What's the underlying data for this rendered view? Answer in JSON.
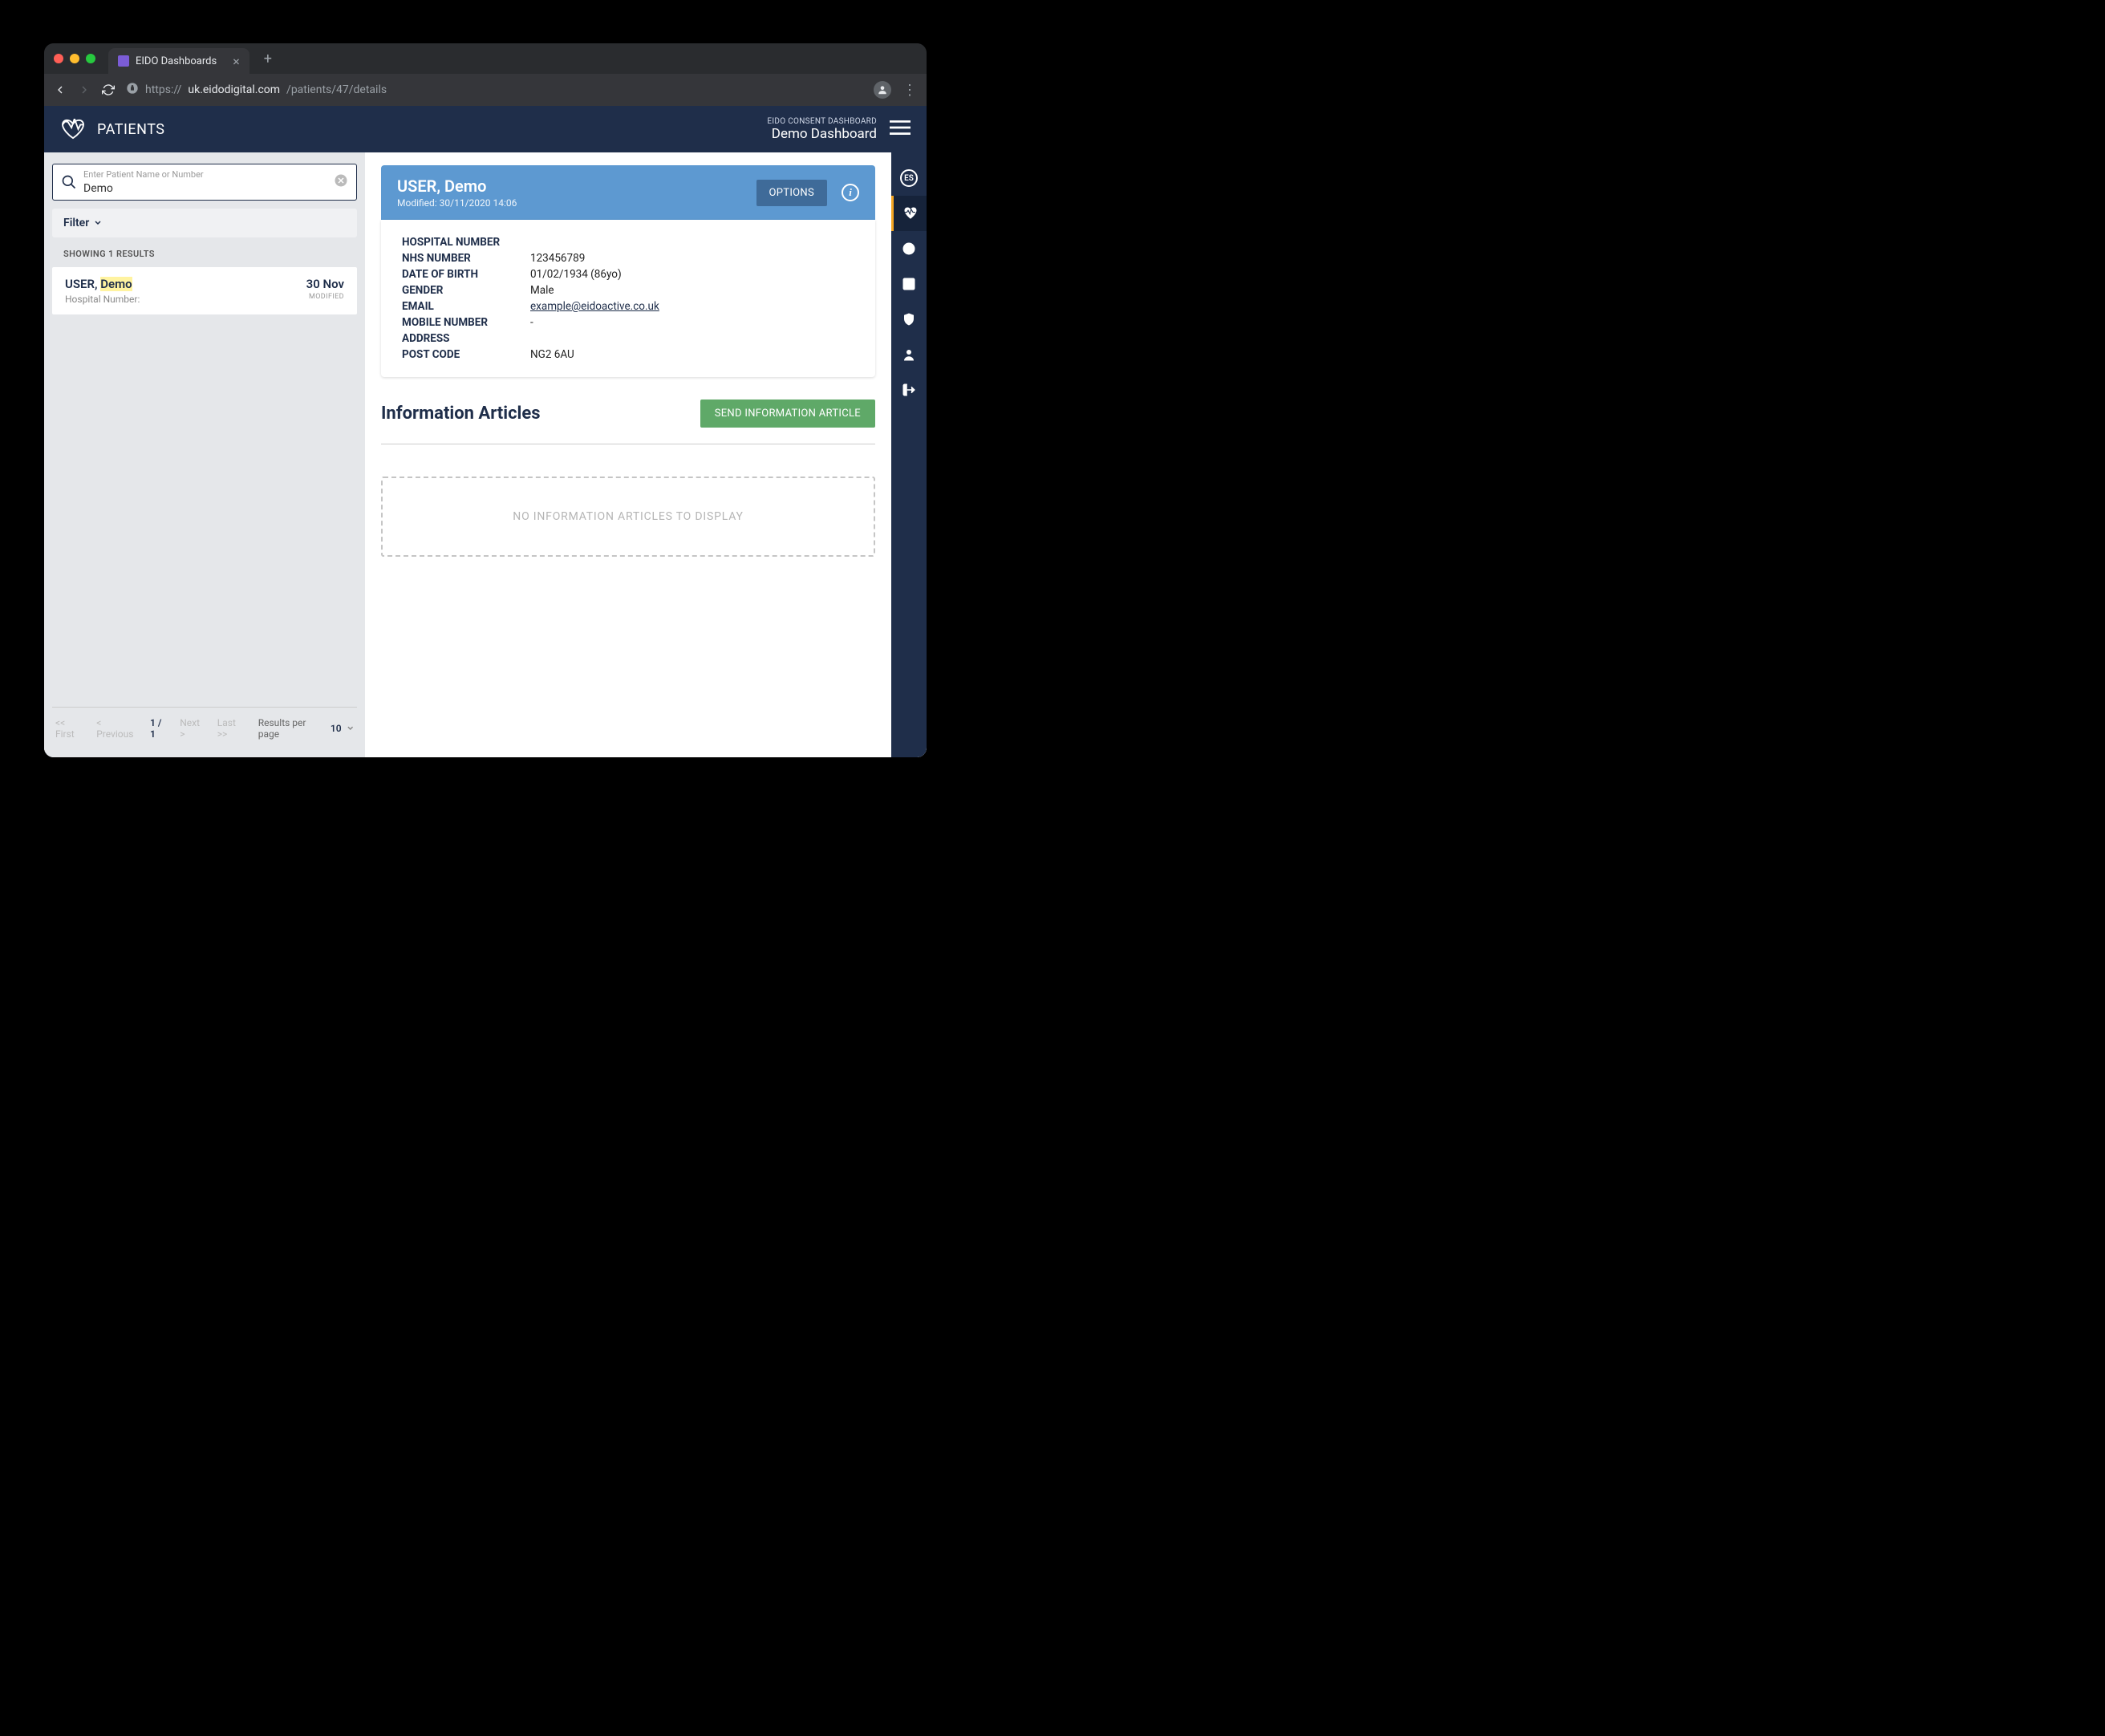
{
  "browser": {
    "tab_title": "EIDO Dashboards",
    "url_host": "uk.eidodigital.com",
    "url_path": "/patients/47/details",
    "url_prefix": "https://"
  },
  "header": {
    "title": "PATIENTS",
    "right_small": "EIDO CONSENT DASHBOARD",
    "right_big": "Demo Dashboard"
  },
  "search": {
    "placeholder": "Enter Patient Name or Number",
    "value": "Demo"
  },
  "filter_label": "Filter",
  "showing_label": "SHOWING 1 RESULTS",
  "results": [
    {
      "name_prefix": "USER, ",
      "name_highlight": "Demo",
      "sub_label": "Hospital Number:",
      "date": "30 Nov",
      "mod_label": "MODIFIED"
    }
  ],
  "pager": {
    "first": "<< First",
    "prev": "<  Previous",
    "current": "1 / 1",
    "next": "Next >",
    "last": "Last >>",
    "rpp_label": "Results per page",
    "rpp_value": "10"
  },
  "patient": {
    "name": "USER, Demo",
    "modified": "Modified: 30/11/2020 14:06",
    "options_label": "OPTIONS",
    "fields": {
      "hospital_number": {
        "label": "HOSPITAL NUMBER",
        "value": ""
      },
      "nhs_number": {
        "label": "NHS NUMBER",
        "value": "123456789"
      },
      "dob": {
        "label": "DATE OF BIRTH",
        "value": "01/02/1934 (86yo)"
      },
      "gender": {
        "label": "GENDER",
        "value": "Male"
      },
      "email": {
        "label": "EMAIL",
        "value": "example@eidoactive.co.uk"
      },
      "mobile": {
        "label": "MOBILE NUMBER",
        "value": "-"
      },
      "address": {
        "label": "ADDRESS",
        "value": ""
      },
      "postcode": {
        "label": "POST CODE",
        "value": "NG2 6AU"
      }
    }
  },
  "articles": {
    "heading": "Information Articles",
    "send_label": "SEND INFORMATION ARTICLE",
    "empty_label": "NO INFORMATION ARTICLES TO DISPLAY"
  },
  "rail": {
    "badge": "ES"
  }
}
